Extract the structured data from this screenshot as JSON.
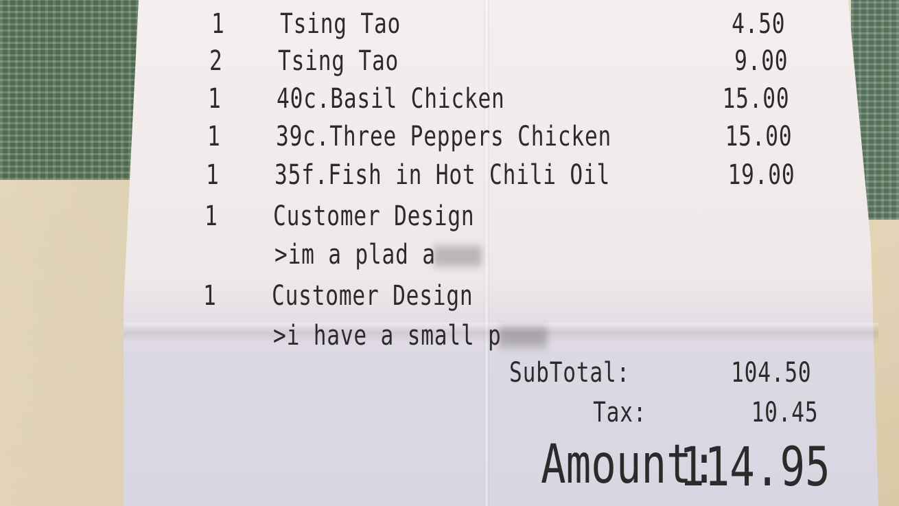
{
  "receipt": {
    "items": [
      {
        "qty": "1",
        "name": "Tsing Tao",
        "price": "4.50"
      },
      {
        "qty": "2",
        "name": "Tsing Tao",
        "price": "9.00"
      },
      {
        "qty": "1",
        "name": "40c.Basil Chicken",
        "price": "15.00"
      },
      {
        "qty": "1",
        "name": "39c.Three Peppers Chicken",
        "price": "15.00"
      },
      {
        "qty": "1",
        "name": "35f.Fish in Hot Chili Oil",
        "price": "19.00"
      },
      {
        "qty": "1",
        "name": "Customer Design",
        "note": ">im a plad a"
      },
      {
        "qty": "1",
        "name": "Customer Design",
        "note": ">i have a small p"
      }
    ],
    "subtotal_label": "SubTotal:",
    "subtotal_value": "104.50",
    "tax_label": "Tax:",
    "tax_value": "10.45",
    "amount_label": "Amount:",
    "amount_value": "114.95"
  }
}
